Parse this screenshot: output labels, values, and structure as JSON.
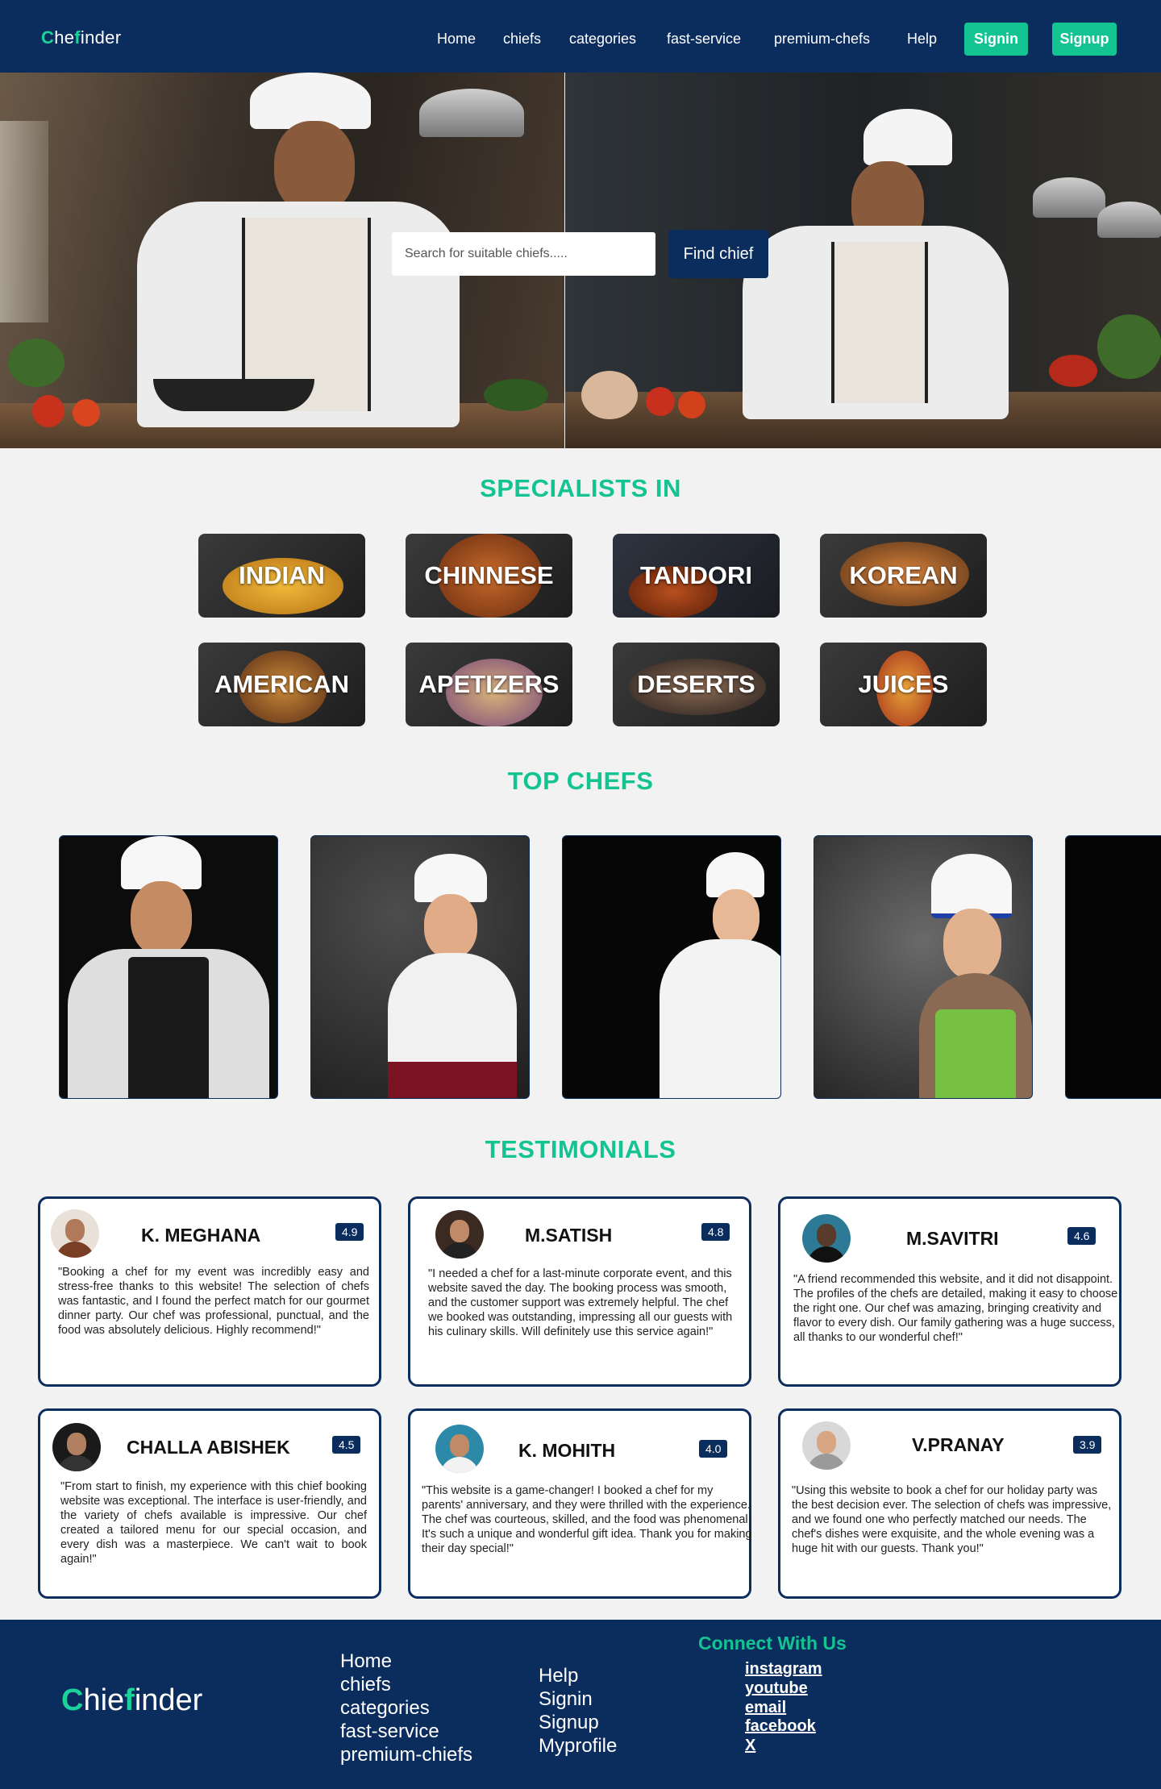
{
  "nav": {
    "logo_c": "C",
    "logo_he": "he",
    "logo_f": "f",
    "logo_inder": "inder",
    "links": [
      "Home",
      "chiefs",
      "categories",
      "fast-service",
      "premium-chefs",
      "Help"
    ],
    "signin": "Signin",
    "signup": "Signup"
  },
  "hero": {
    "search_placeholder": "Search for suitable chiefs.....",
    "find_button": "Find chief"
  },
  "specialists": {
    "title": "SPECIALISTS IN",
    "categories": [
      "INDIAN",
      "CHINNESE",
      "TANDORI",
      "KOREAN",
      "AMERICAN",
      "APETIZERS",
      "DESERTS",
      "JUICES"
    ]
  },
  "top_chefs": {
    "title": "TOP CHEFS"
  },
  "testimonials": {
    "title": "TESTIMONIALS",
    "items": [
      {
        "name": "K. MEGHANA",
        "rating": "4.9",
        "text": "\"Booking a chef for my event was incredibly easy and stress-free thanks to this website! The selection of chefs was fantastic, and I found the perfect match for our gourmet dinner party. Our chef was professional, punctual, and the food was absolutely delicious. Highly recommend!\""
      },
      {
        "name": "M.SATISH",
        "rating": "4.8",
        "text": "\"I needed a chef for a last-minute corporate event, and this website saved the day. The booking process was smooth, and the customer support was extremely helpful. The chef we booked was outstanding, impressing all our guests with his culinary skills. Will definitely use this service again!\""
      },
      {
        "name": "M.SAVITRI",
        "rating": "4.6",
        "text": "\"A friend recommended this website, and it did not disappoint. The profiles of the chefs are detailed, making it easy to choose the right one. Our chef was amazing, bringing creativity and flavor to every dish. Our family gathering was a huge success, all thanks to our wonderful chef!\""
      },
      {
        "name": "CHALLA ABISHEK",
        "rating": "4.5",
        "text": "\"From start to finish, my experience with this chief booking website was exceptional. The interface is user-friendly, and the variety of chefs available is impressive. Our chef created a tailored menu for our special occasion, and every dish was a masterpiece. We can't wait to book again!\""
      },
      {
        "name": "K. MOHITH",
        "rating": "4.0",
        "text": "\"This website is a game-changer! I booked a chef for my parents' anniversary, and they were thrilled with the experience. The chef was courteous, skilled, and the food was phenomenal. It's such a unique and wonderful gift idea. Thank you for making their day special!\""
      },
      {
        "name": "V.PRANAY",
        "rating": "3.9",
        "text": "\"Using this website to book a chef for our holiday party was the best decision ever. The selection of chefs was impressive, and we found one who perfectly matched our needs. The chef's dishes were exquisite, and the whole evening was a huge hit with our guests. Thank you!\""
      }
    ]
  },
  "footer": {
    "logo_c": "C",
    "logo_hie": "hie",
    "logo_f": "f",
    "logo_inder": "inder",
    "col1": [
      "Home",
      "chiefs",
      "categories",
      "fast-service",
      "premium-chiefs"
    ],
    "col2": [
      "Help",
      "Signin",
      "Signup",
      "Myprofile"
    ],
    "connect_title": "Connect With Us",
    "social": [
      "instagram",
      "youtube",
      "email",
      "facebook",
      "X"
    ]
  },
  "colors": {
    "navy": "#0b2d5e",
    "accent": "#13c492",
    "background": "#f2f2f2"
  }
}
